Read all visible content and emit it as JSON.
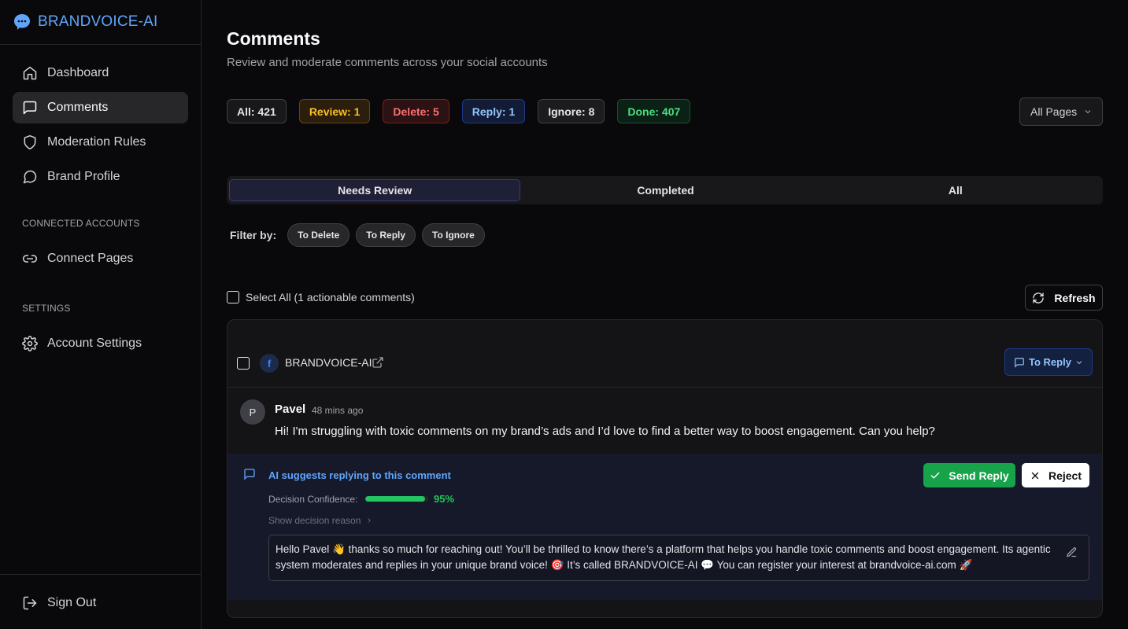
{
  "sidebar": {
    "brand": "BRANDVOICE-AI",
    "items": [
      {
        "label": "Dashboard",
        "icon": "home-icon"
      },
      {
        "label": "Comments",
        "icon": "message-square-icon"
      },
      {
        "label": "Moderation Rules",
        "icon": "shield-icon"
      },
      {
        "label": "Brand Profile",
        "icon": "message-circle-icon"
      }
    ],
    "connected_section": "CONNECTED ACCOUNTS",
    "connect_pages": "Connect Pages",
    "settings_section": "SETTINGS",
    "account_settings": "Account Settings",
    "sign_out": "Sign Out"
  },
  "header": {
    "title": "Comments",
    "subtitle": "Review and moderate comments across your social accounts"
  },
  "stats": {
    "all": "All: 421",
    "review": "Review: 1",
    "delete": "Delete: 5",
    "reply": "Reply: 1",
    "ignore": "Ignore: 8",
    "done": "Done: 407"
  },
  "page_filter": {
    "selected": "All Pages"
  },
  "tabs": [
    "Needs Review",
    "Completed",
    "All"
  ],
  "filter": {
    "label": "Filter by:",
    "chips": [
      "To Delete",
      "To Reply",
      "To Ignore"
    ]
  },
  "select_all": "Select All (1 actionable comments)",
  "refresh": "Refresh",
  "card": {
    "page_name": "BRANDVOICE-AI",
    "platform_badge": "f",
    "action_label": "To Reply",
    "comment": {
      "avatar": "P",
      "author": "Pavel",
      "time": "48 mins ago",
      "text": "Hi! I'm struggling with toxic comments on my brand’s ads and I’d love to find a better way to boost engagement. Can you help?"
    },
    "ai": {
      "title": "AI suggests replying to this comment",
      "send": "Send Reply",
      "reject": "Reject",
      "confidence_label": "Decision Confidence:",
      "confidence_value": "95%",
      "confidence_fraction": 0.95,
      "reason_label": "Show decision reason",
      "reply": "Hello Pavel 👋 thanks so much for reaching out! You’ll be thrilled to know there’s a platform that helps you handle toxic comments and boost engagement. Its agentic system moderates and replies in your unique brand voice! 🎯 It’s called BRANDVOICE-AI 💬 You can register your interest at brandvoice-ai.com 🚀"
    }
  },
  "colors": {
    "accent": "#60a5fa",
    "success": "#22c55e",
    "background": "#09090b"
  }
}
